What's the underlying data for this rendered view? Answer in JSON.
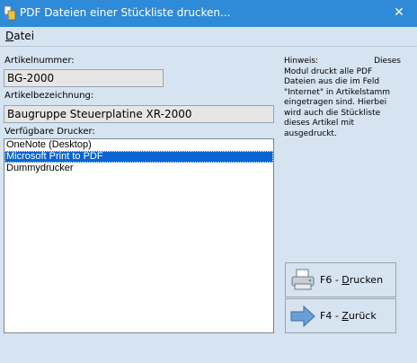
{
  "window": {
    "title": "PDF Dateien einer Stückliste drucken...",
    "close_symbol": "✕"
  },
  "menu": {
    "items": [
      {
        "label_underlined": "D",
        "label_rest": "atei"
      }
    ]
  },
  "fields": {
    "artikelnummer_label": "Artikelnummer:",
    "artikelnummer_value": "BG-2000",
    "artikelbezeichnung_label": "Artikelbezeichnung:",
    "artikelbezeichnung_value": "Baugruppe Steuerplatine XR-2000",
    "drucker_label": "Verfügbare Drucker:"
  },
  "printers": [
    {
      "name": "OneNote (Desktop)",
      "selected": false
    },
    {
      "name": "Microsoft Print to PDF",
      "selected": true
    },
    {
      "name": "Dummydrucker",
      "selected": false
    }
  ],
  "hint": {
    "head_left": "Hinweis:",
    "head_right": "Dieses",
    "body": "Modul druckt alle PDF Dateien aus die im Feld \"Internet\" in Artikelstamm eingetragen sind. Hierbei wird auch die Stückliste dieses Artikel mit ausgedruckt."
  },
  "buttons": {
    "print": {
      "prefix": "F6 - ",
      "underlined": "D",
      "rest": "rucken",
      "icon": "printer-icon"
    },
    "back": {
      "prefix": "F4 - ",
      "underlined": "Z",
      "rest": "urück",
      "icon": "arrow-right-icon"
    }
  },
  "colors": {
    "titlebar": "#2f8ad8",
    "background": "#d6e3f0",
    "selection": "#0a64d2"
  }
}
